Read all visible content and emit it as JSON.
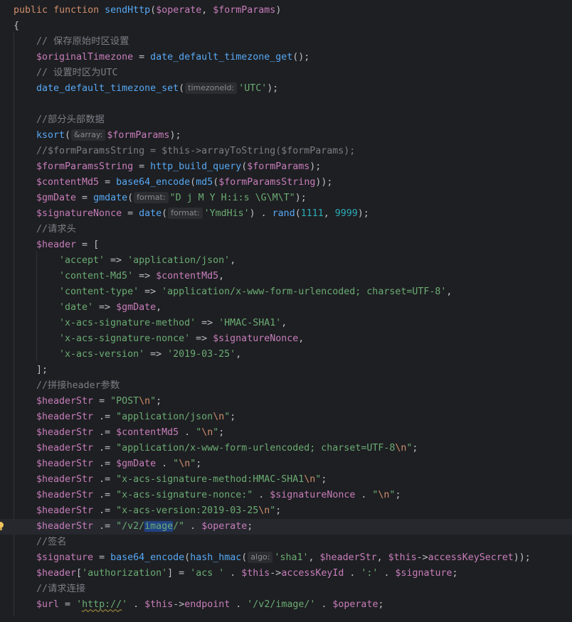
{
  "code": {
    "l1": {
      "kw1": "public",
      "kw2": "function",
      "fn": "sendHttp",
      "p1": "(",
      "v1": "$operate",
      "p2": ", ",
      "v2": "$formParams",
      "p3": ")"
    },
    "l2": {
      "t": "{"
    },
    "l3": {
      "cm": "// 保存原始时区设置"
    },
    "l4": {
      "v": "$originalTimezone",
      "op": " = ",
      "f": "date_default_timezone_get",
      "p": "();"
    },
    "l5": {
      "cm": "// 设置时区为UTC"
    },
    "l6": {
      "f": "date_default_timezone_set",
      "p1": "(",
      "hint": "timezoneId:",
      "s": "'UTC'",
      "p2": ");"
    },
    "l8": {
      "cm": "//部分头部数据"
    },
    "l9": {
      "f": "ksort",
      "p1": "(",
      "hint": "&array:",
      "v": "$formParams",
      "p2": ");"
    },
    "l10": {
      "cm": "//$formParamsString = $this->arrayToString($formParams);"
    },
    "l11": {
      "v": "$formParamsString",
      "op": " = ",
      "f": "http_build_query",
      "p1": "(",
      "v2": "$formParams",
      "p2": ");"
    },
    "l12": {
      "v": "$contentMd5",
      "op": " = ",
      "f": "base64_encode",
      "p1": "(",
      "f2": "md5",
      "p2": "(",
      "v2": "$formParamsString",
      "p3": "));"
    },
    "l13": {
      "v": "$gmDate",
      "op": " = ",
      "f": "gmdate",
      "p1": "(",
      "hint": "format:",
      "s": "\"D j M Y H:i:s \\G\\M\\T\"",
      "p2": ");"
    },
    "l14": {
      "v": "$signatureNonce",
      "op": " = ",
      "f": "date",
      "p1": "(",
      "hint": "format:",
      "s": "'YmdHis'",
      "p2": ") . ",
      "f2": "rand",
      "p3": "(",
      "n1": "1111",
      "p4": ", ",
      "n2": "9999",
      "p5": ");"
    },
    "l15": {
      "cm": "//请求头"
    },
    "l16": {
      "v": "$header",
      "op": " = ["
    },
    "l17": {
      "k": "'accept'",
      "op": " => ",
      "val": "'application/json'",
      "p": ","
    },
    "l18": {
      "k": "'content-Md5'",
      "op": " => ",
      "val": "$contentMd5",
      "p": ","
    },
    "l19": {
      "k": "'content-type'",
      "op": " => ",
      "val": "'application/x-www-form-urlencoded; charset=UTF-8'",
      "p": ","
    },
    "l20": {
      "k": "'date'",
      "op": " => ",
      "val": "$gmDate",
      "p": ","
    },
    "l21": {
      "k": "'x-acs-signature-method'",
      "op": " => ",
      "val": "'HMAC-SHA1'",
      "p": ","
    },
    "l22": {
      "k": "'x-acs-signature-nonce'",
      "op": " => ",
      "val": "$signatureNonce",
      "p": ","
    },
    "l23": {
      "k": "'x-acs-version'",
      "op": " => ",
      "val": "'2019-03-25'",
      "p": ","
    },
    "l24": {
      "t": "];"
    },
    "l25": {
      "cm": "//拼接header参数"
    },
    "l26": {
      "v": "$headerStr",
      "op": " = ",
      "s": "\"POST",
      "e": "\\n",
      "s2": "\"",
      "p": ";"
    },
    "l27": {
      "v": "$headerStr",
      "op": " .= ",
      "s": "\"application/json",
      "e": "\\n",
      "s2": "\"",
      "p": ";"
    },
    "l28": {
      "v": "$headerStr",
      "op": " .= ",
      "v2": "$contentMd5",
      "op2": " . ",
      "s": "\"",
      "e": "\\n",
      "s2": "\"",
      "p": ";"
    },
    "l29": {
      "v": "$headerStr",
      "op": " .= ",
      "s": "\"application/x-www-form-urlencoded; charset=UTF-8",
      "e": "\\n",
      "s2": "\"",
      "p": ";"
    },
    "l30": {
      "v": "$headerStr",
      "op": " .= ",
      "v2": "$gmDate",
      "op2": " . ",
      "s": "\"",
      "e": "\\n",
      "s2": "\"",
      "p": ";"
    },
    "l31": {
      "v": "$headerStr",
      "op": " .= ",
      "s": "\"x-acs-signature-method:HMAC-SHA1",
      "e": "\\n",
      "s2": "\"",
      "p": ";"
    },
    "l32": {
      "v": "$headerStr",
      "op": " .= ",
      "s": "\"x-acs-signature-nonce:\"",
      "op2": " . ",
      "v2": "$signatureNonce",
      "op3": " . ",
      "s2": "\"",
      "e": "\\n",
      "s3": "\"",
      "p": ";"
    },
    "l33": {
      "v": "$headerStr",
      "op": " .= ",
      "s": "\"x-acs-version:2019-03-25",
      "e": "\\n",
      "s2": "\"",
      "p": ";"
    },
    "l34": {
      "v": "$headerStr",
      "op": " .= ",
      "s": "\"/v2/",
      "sel": "image",
      "s2": "/\"",
      "op2": " . ",
      "v2": "$operate",
      "p": ";"
    },
    "l35": {
      "cm": "//签名"
    },
    "l36": {
      "v": "$signature",
      "op": " = ",
      "f": "base64_encode",
      "p1": "(",
      "f2": "hash_hmac",
      "p2": "(",
      "hint": "algo:",
      "s": "'sha1'",
      "p3": ", ",
      "v2": "$headerStr",
      "p4": ", ",
      "v3": "$this",
      "ar": "->",
      "pr": "accessKeySecret",
      "p5": "));"
    },
    "l37": {
      "v": "$header",
      "p1": "[",
      "s": "'authorization'",
      "p2": "] = ",
      "s2": "'acs '",
      "op": " . ",
      "v2": "$this",
      "ar": "->",
      "pr": "accessKeyId",
      "op2": " . ",
      "s3": "':'",
      "op3": " . ",
      "v3": "$signature",
      "p3": ";"
    },
    "l38": {
      "cm": "//请求连接"
    },
    "l39": {
      "v": "$url",
      "op": " = ",
      "s1": "'",
      "u": "http://",
      "s2": "'",
      "op2": " . ",
      "v2": "$this",
      "ar": "->",
      "pr": "endpoint",
      "op3": " . ",
      "s3": "'/v2/image/'",
      "op4": " . ",
      "v3": "$operate",
      "p": ";"
    }
  },
  "icons": {
    "gutter_bulb": "lightbulb-icon"
  },
  "colors": {
    "background": "#1e1f22",
    "keyword": "#cf8e6d",
    "function": "#56a8f5",
    "variable": "#c77dbb",
    "string": "#6aab73",
    "number": "#2aacb8",
    "comment": "#7a7e85"
  }
}
